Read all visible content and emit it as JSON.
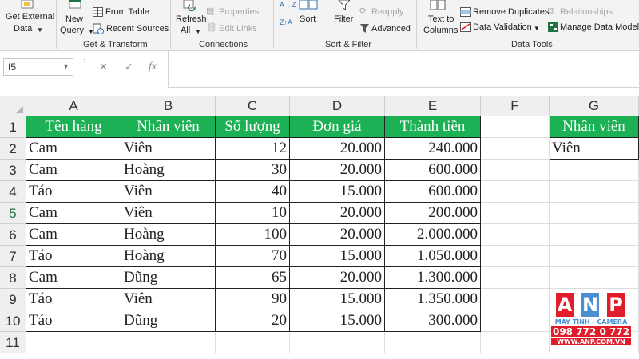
{
  "ribbon": {
    "get_external_data": [
      "Get External",
      "Data"
    ],
    "new_query": [
      "New",
      "Query"
    ],
    "from_table": "From Table",
    "recent_sources": "Recent Sources",
    "get_transform": "Get & Transform",
    "refresh_all": [
      "Refresh",
      "All"
    ],
    "properties": "Properties",
    "edit_links": "Edit Links",
    "connections": "Connections",
    "sort": "Sort",
    "filter": "Filter",
    "reapply": "Reapply",
    "advanced": "Advanced",
    "sort_filter": "Sort & Filter",
    "text_to_columns": [
      "Text to",
      "Columns"
    ],
    "remove_duplicates": "Remove Duplicates",
    "data_validation": "Data Validation",
    "relationships": "Relationships",
    "manage_data_model": "Manage Data Model",
    "data_tools": "Data Tools",
    "sort_az_icon": "A→Z",
    "sort_za_icon": "Z↑A"
  },
  "formula_bar": {
    "name_box": "I5",
    "cancel_icon": "✕",
    "enter_icon": "✓",
    "fx_icon": "fx",
    "formula": ""
  },
  "grid": {
    "columns": [
      "A",
      "B",
      "C",
      "D",
      "E",
      "F",
      "G"
    ],
    "rows": [
      "1",
      "2",
      "3",
      "4",
      "5",
      "6",
      "7",
      "8",
      "9",
      "10",
      "11"
    ],
    "selected_row": "5",
    "table_headers": [
      "Tên hàng",
      "Nhân viên",
      "Số lượng",
      "Đơn giá",
      "Thành tiền"
    ],
    "table_rows": [
      [
        "Cam",
        "Viên",
        "12",
        "20.000",
        "240.000"
      ],
      [
        "Cam",
        "Hoàng",
        "30",
        "20.000",
        "600.000"
      ],
      [
        "Táo",
        "Viên",
        "40",
        "15.000",
        "600.000"
      ],
      [
        "Cam",
        "Viên",
        "10",
        "20.000",
        "200.000"
      ],
      [
        "Cam",
        "Hoàng",
        "100",
        "20.000",
        "2.000.000"
      ],
      [
        "Táo",
        "Hoàng",
        "70",
        "15.000",
        "1.050.000"
      ],
      [
        "Cam",
        "Dũng",
        "65",
        "20.000",
        "1.300.000"
      ],
      [
        "Táo",
        "Viên",
        "90",
        "15.000",
        "1.350.000"
      ],
      [
        "Táo",
        "Dũng",
        "20",
        "15.000",
        "300.000"
      ]
    ],
    "criteria_header": "Nhân viên",
    "criteria_value": "Viên"
  },
  "watermark": {
    "letters": [
      "A",
      "N",
      "P"
    ],
    "line1": "MÁY TÍNH - CAMERA",
    "line2": "098 772 0 772",
    "line3": "WWW.ANP.COM.VN"
  },
  "colors": {
    "header_fill": "#1bb154",
    "excel_green": "#217346",
    "watermark_red": "#e11d2b",
    "watermark_blue": "#4a8fd1"
  }
}
